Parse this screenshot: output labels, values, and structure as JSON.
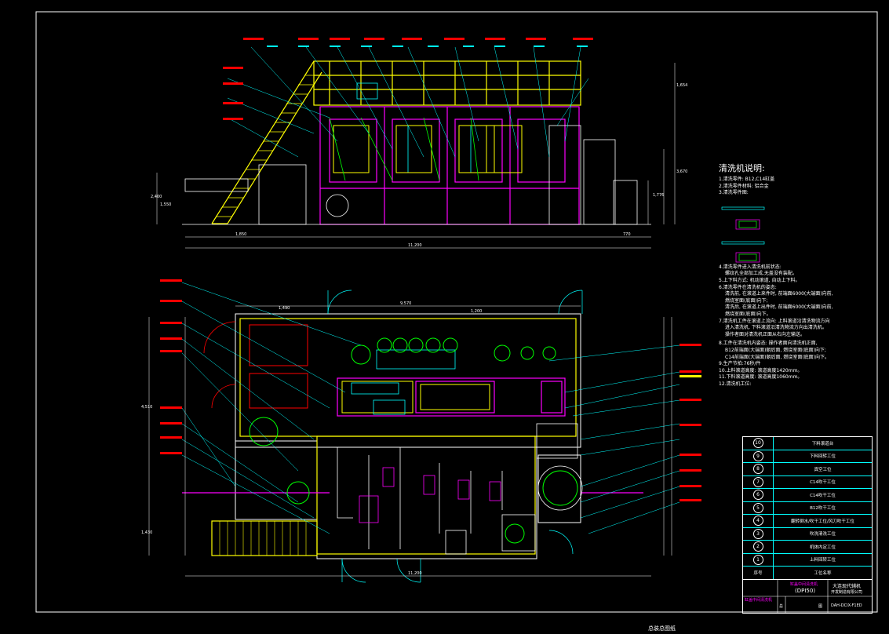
{
  "notes": {
    "title": "清洗机说明:",
    "items": [
      "1.清洗零件: B12,C14缸盖",
      "2.清洗零件材料: 铝合金",
      "3.清洗零件图:",
      "4.清洗零件进入清洗机前状态:",
      "螺纹孔全部加工成,无盖没有装配。",
      "5.上下料方式: 机动滚道, 自动上下料。",
      "6.清洗零件在清洗机的姿态:",
      "清洗前, 在滚道上来件时, 前端面6000(大端面)向前,",
      "燃烧室面(底面)向下;",
      "清洗后, 在滚道上出件时, 前端面6000(大端面)向前,",
      "燃烧室面(底面)向下。",
      "7.清洗机工件在滚道上流向: 上料滚道沿清洗物流方向",
      "进入清洗机, 下料滚道沿清洗物流方向出清洗机。",
      "操作者面对清洗机正面从右向左输送。",
      "8.工件在清洗机内姿态: 操作者面向清洗机正面,",
      "B12前端面(大端面)朝后面, 燃烧室面(底面)向下;",
      "C14前端面(大端面)朝后面, 燃烧室面(底面)向下。",
      "9.生产节拍:76秒/件",
      "10.上料滚道高度: 滚道高度1420mm。",
      "11.下料滚道高度: 滚道高度1060mm。",
      "12.清洗机工位:"
    ]
  },
  "stations": [
    {
      "no": "10",
      "name": "下料滚道台"
    },
    {
      "no": "9",
      "name": "下料回转工位"
    },
    {
      "no": "8",
      "name": "真空工位"
    },
    {
      "no": "7",
      "name": "C14吹干工位"
    },
    {
      "no": "6",
      "name": "C14吹干工位"
    },
    {
      "no": "5",
      "name": "B12吹干工位"
    },
    {
      "no": "4",
      "name": "翻转倒水/吹干工位/风刀吹干工位"
    },
    {
      "no": "3",
      "name": "吹洗清洗工位"
    },
    {
      "no": "2",
      "name": "机体内定工位"
    },
    {
      "no": "1",
      "name": "上料回转工位"
    },
    {
      "no": "序号",
      "name": "工位名称"
    }
  ],
  "title_block": {
    "drawing_name_1": "缸盖中间清洗机",
    "drawing_code": "(DPI50)",
    "company_1": "大连现代辅机",
    "company_2": "开发制造有限公司",
    "drawing_name_2": "缸盖中间清洗机",
    "sheet": "总",
    "sheet2": "图",
    "number": "DAH-DCIX-F1ED"
  },
  "footer": "总装总图纸",
  "dims": {
    "top_total": "11,200",
    "top_left": "1,850",
    "plan_total": "9,570",
    "plan_total2": "11,200",
    "h1": "1,654",
    "h2": "3,670",
    "h3": "1,776",
    "h4": "2,400",
    "h5": "1,550",
    "left_h": "4,510",
    "left_h2": "1,430",
    "d1": "1,490",
    "d2": "1,200",
    "d3": "770"
  },
  "colors": {
    "frame": "#ffffff",
    "yellow": "#ffff00",
    "magenta": "#ff00ff",
    "cyan": "#00ffff",
    "red": "#ff0000",
    "green": "#00ff00",
    "blue": "#3060ff"
  }
}
